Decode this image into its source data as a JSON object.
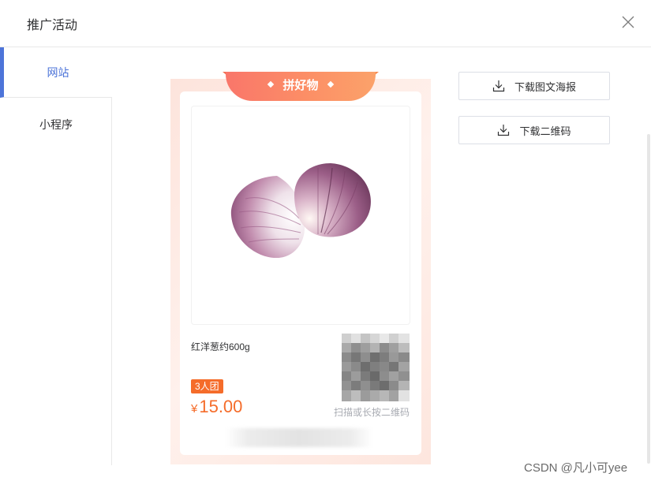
{
  "dialog": {
    "title": "推广活动"
  },
  "sidebar": {
    "items": [
      {
        "label": "网站",
        "active": true
      },
      {
        "label": "小程序",
        "active": false
      }
    ]
  },
  "poster": {
    "banner": "拼好物",
    "product_name": "红洋葱约600g",
    "group_badge": "3人团",
    "currency": "¥",
    "price": "15.00",
    "qr_hint": "扫描或长按二维码"
  },
  "actions": {
    "download_poster": "下载图文海报",
    "download_qr": "下载二维码"
  },
  "watermark": "CSDN @凡小可yee",
  "colors": {
    "accent": "#4d74d9",
    "price": "#f56c2a",
    "banner_start": "#f9766a",
    "banner_end": "#fba26a"
  },
  "icons": {
    "close": "close-icon",
    "download": "download-icon"
  }
}
